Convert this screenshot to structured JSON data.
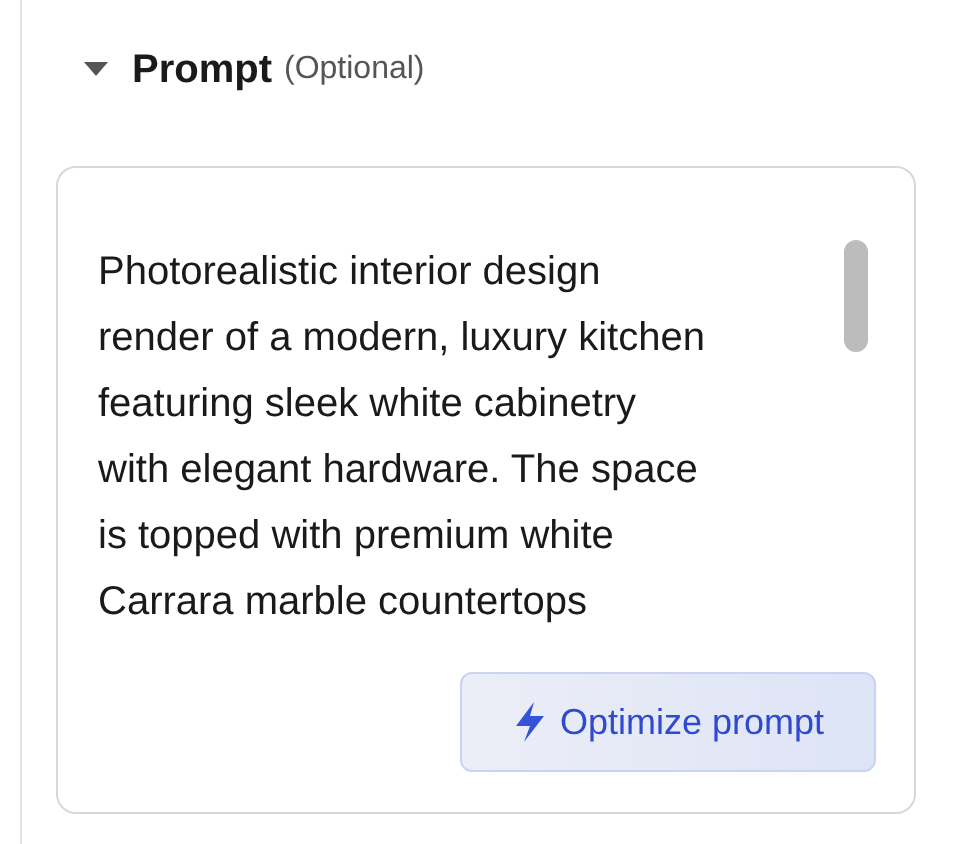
{
  "section": {
    "title": "Prompt",
    "note": "(Optional)",
    "expanded": true
  },
  "prompt": {
    "lines": [
      "Photorealistic interior design",
      "render of a modern, luxury kitchen",
      "featuring sleek white cabinetry",
      "with elegant hardware. The space",
      "is topped with premium white",
      "Carrara marble countertops"
    ]
  },
  "button": {
    "label": "Optimize prompt"
  }
}
